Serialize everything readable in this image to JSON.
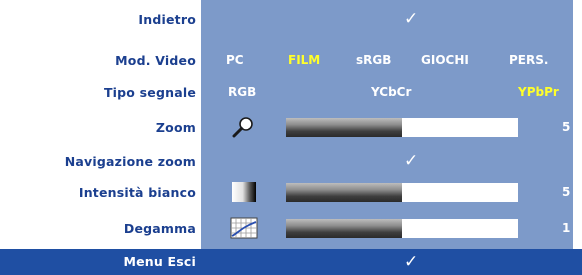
{
  "menu": {
    "back": {
      "label": "Indietro",
      "check": "✓"
    },
    "video_mode": {
      "label": "Mod. Video",
      "options": [
        "PC",
        "FILM",
        "sRGB",
        "GIOCHI",
        "PERS."
      ],
      "selected": "FILM"
    },
    "signal_type": {
      "label": "Tipo segnale",
      "options": [
        "RGB",
        "YCbCr",
        "YPbPr"
      ],
      "selected": "YPbPr"
    },
    "zoom": {
      "label": "Zoom",
      "icon": "magnifier-icon",
      "value": "5",
      "level": 0.5
    },
    "zoom_nav": {
      "label": "Navigazione zoom",
      "check": "✓"
    },
    "white_intensity": {
      "label": "Intensità bianco",
      "icon": "white-intensity-icon",
      "value": "5",
      "level": 0.5
    },
    "degamma": {
      "label": "Degamma",
      "icon": "degamma-curve-icon",
      "value": "1",
      "level": 0.5
    },
    "exit": {
      "label": "Menu Esci",
      "check": "✓"
    }
  },
  "colors": {
    "panel": "#7d9ac9",
    "label_text": "#1b3f8f",
    "selected_option": "#ffff2a",
    "exit_bar": "#1f4fa3"
  }
}
